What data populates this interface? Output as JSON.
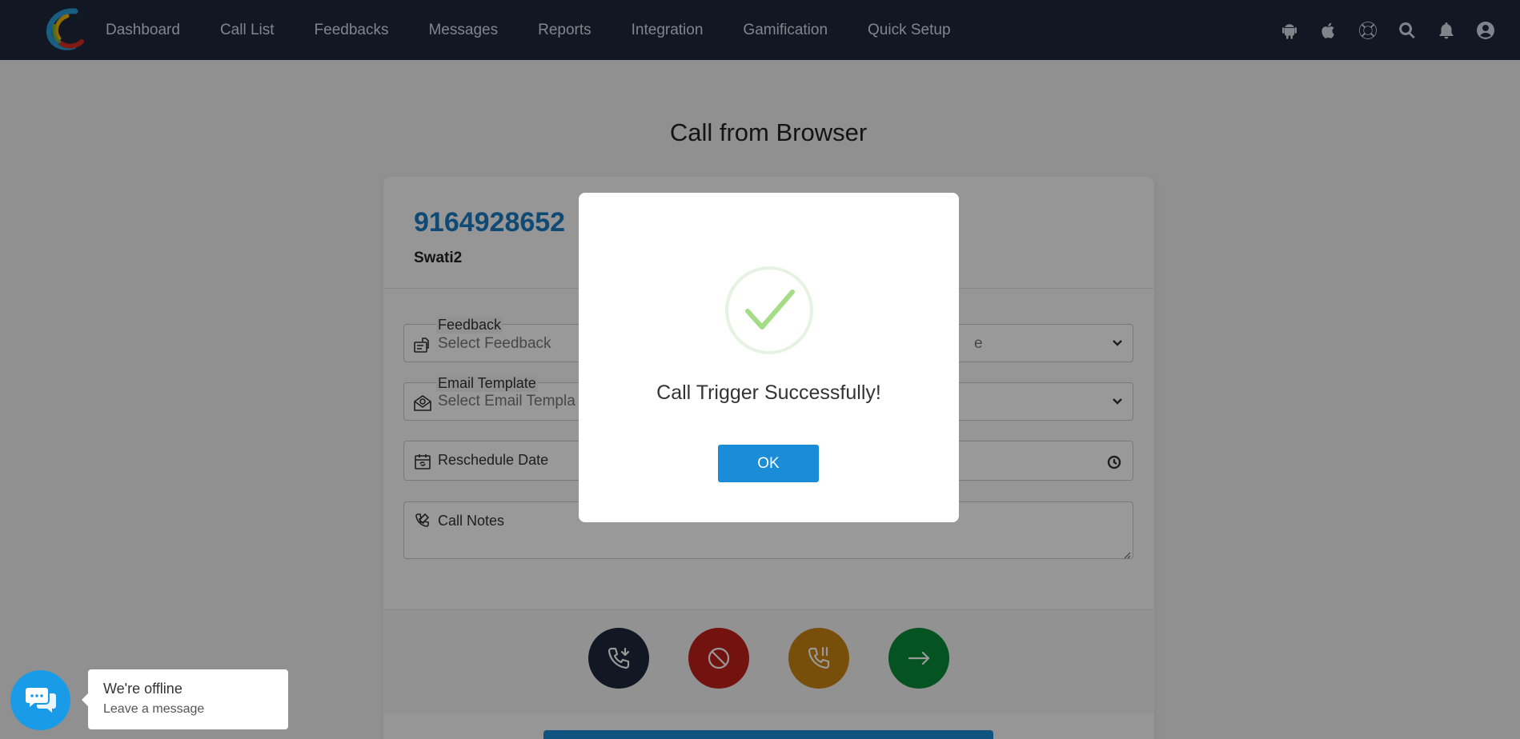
{
  "nav": {
    "items": [
      {
        "label": "Dashboard"
      },
      {
        "label": "Call List"
      },
      {
        "label": "Feedbacks"
      },
      {
        "label": "Messages"
      },
      {
        "label": "Reports"
      },
      {
        "label": "Integration"
      },
      {
        "label": "Gamification"
      },
      {
        "label": "Quick Setup"
      }
    ],
    "icons": [
      "android-icon",
      "apple-icon",
      "lifebuoy-icon",
      "search-icon",
      "bell-icon",
      "user-icon"
    ]
  },
  "page": {
    "title": "Call from Browser"
  },
  "contact": {
    "phone": "9164928652",
    "name": "Swati2"
  },
  "form": {
    "feedback_label": "Feedback",
    "feedback_value": "Select Feedback",
    "right_select_partial": "e",
    "email_template_label": "Email Template",
    "email_template_value": "Select Email Templa",
    "reschedule_label": "Reschedule Date",
    "call_notes_label": "Call Notes"
  },
  "actions": [
    {
      "name": "incoming-call",
      "color": "#1e293b"
    },
    {
      "name": "block",
      "color": "#c0201b"
    },
    {
      "name": "hold-call",
      "color": "#c98412"
    },
    {
      "name": "next",
      "color": "#0b8a3a"
    }
  ],
  "modal": {
    "message": "Call Trigger Successfully!",
    "ok_label": "OK"
  },
  "chat": {
    "title": "We're offline",
    "subtitle": "Leave a message"
  },
  "colors": {
    "nav_bg": "#1e293b",
    "accent": "#1a8cd8",
    "phone": "#1a7cc1",
    "success": "#a5dc86"
  }
}
